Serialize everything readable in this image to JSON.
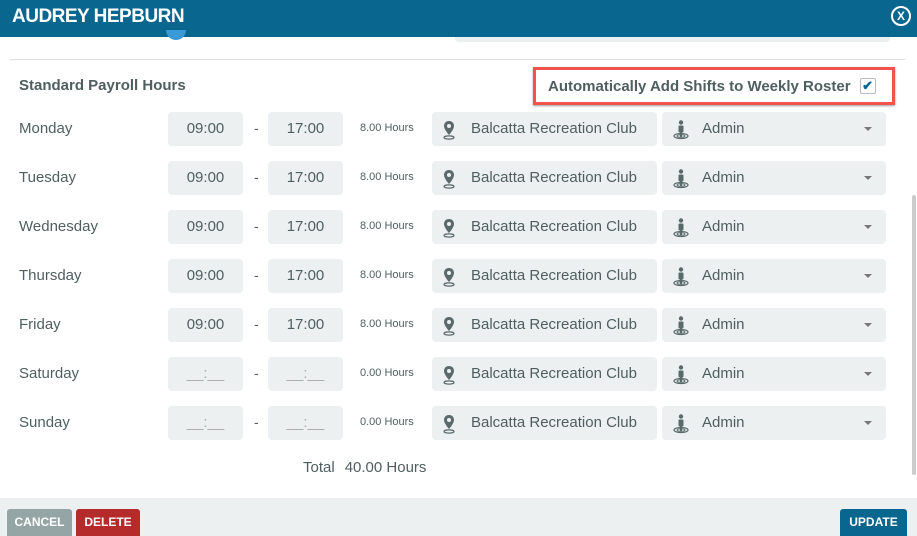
{
  "header": {
    "title": "AUDREY HEPBURN",
    "close_label": "X"
  },
  "section_title": "Standard Payroll Hours",
  "auto_add": {
    "label": "Automatically Add Shifts to Weekly Roster",
    "checked": true,
    "check_glyph": "✔"
  },
  "separator": "-",
  "rows": [
    {
      "day": "Monday",
      "start": "09:00",
      "end": "17:00",
      "hours": "8.00 Hours",
      "location": "Balcatta Recreation Club",
      "role": "Admin"
    },
    {
      "day": "Tuesday",
      "start": "09:00",
      "end": "17:00",
      "hours": "8.00 Hours",
      "location": "Balcatta Recreation Club",
      "role": "Admin"
    },
    {
      "day": "Wednesday",
      "start": "09:00",
      "end": "17:00",
      "hours": "8.00 Hours",
      "location": "Balcatta Recreation Club",
      "role": "Admin"
    },
    {
      "day": "Thursday",
      "start": "09:00",
      "end": "17:00",
      "hours": "8.00 Hours",
      "location": "Balcatta Recreation Club",
      "role": "Admin"
    },
    {
      "day": "Friday",
      "start": "09:00",
      "end": "17:00",
      "hours": "8.00 Hours",
      "location": "Balcatta Recreation Club",
      "role": "Admin"
    },
    {
      "day": "Saturday",
      "start": "__:__",
      "end": "__:__",
      "hours": "0.00 Hours",
      "location": "Balcatta Recreation Club",
      "role": "Admin"
    },
    {
      "day": "Sunday",
      "start": "__:__",
      "end": "__:__",
      "hours": "0.00 Hours",
      "location": "Balcatta Recreation Club",
      "role": "Admin"
    }
  ],
  "total": {
    "label": "Total",
    "value": "40.00 Hours"
  },
  "footer": {
    "cancel": "CANCEL",
    "delete": "DELETE",
    "update": "UPDATE"
  },
  "colors": {
    "header": "#08668f",
    "highlight": "#f0544a",
    "delete": "#b52a2a",
    "cancel": "#95a5a6"
  },
  "icons": {
    "location": "map-pin-icon",
    "role": "person-pin-icon",
    "dropdown": "caret-down-icon"
  }
}
